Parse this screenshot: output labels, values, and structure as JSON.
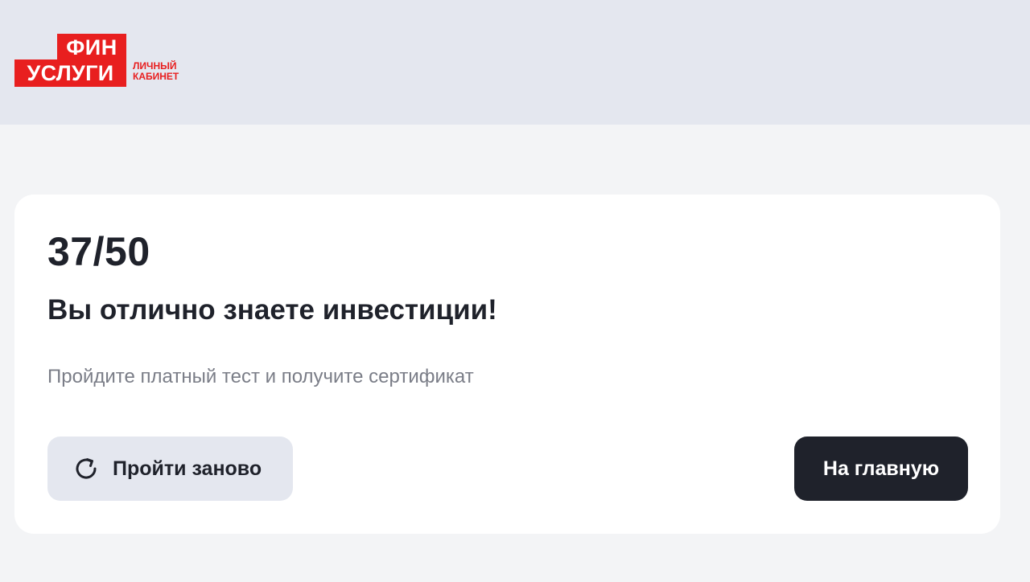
{
  "header": {
    "logo": {
      "line1": "ФИН",
      "line2": "УСЛУГИ",
      "sub1": "ЛИЧНЫЙ",
      "sub2": "КАБИНЕТ",
      "brand_color": "#e81f1f"
    }
  },
  "result": {
    "score": "37/50",
    "title": "Вы отлично знаете инвестиции!",
    "subtitle": "Пройдите платный тест и получите сертификат"
  },
  "actions": {
    "retry_label": "Пройти заново",
    "retry_icon": "refresh-icon",
    "home_label": "На главную"
  },
  "colors": {
    "header_bg": "#e4e7ef",
    "page_bg": "#f3f4f6",
    "text_primary": "#1f222b",
    "text_secondary": "#7a7d87",
    "dark_button": "#1f222b"
  }
}
